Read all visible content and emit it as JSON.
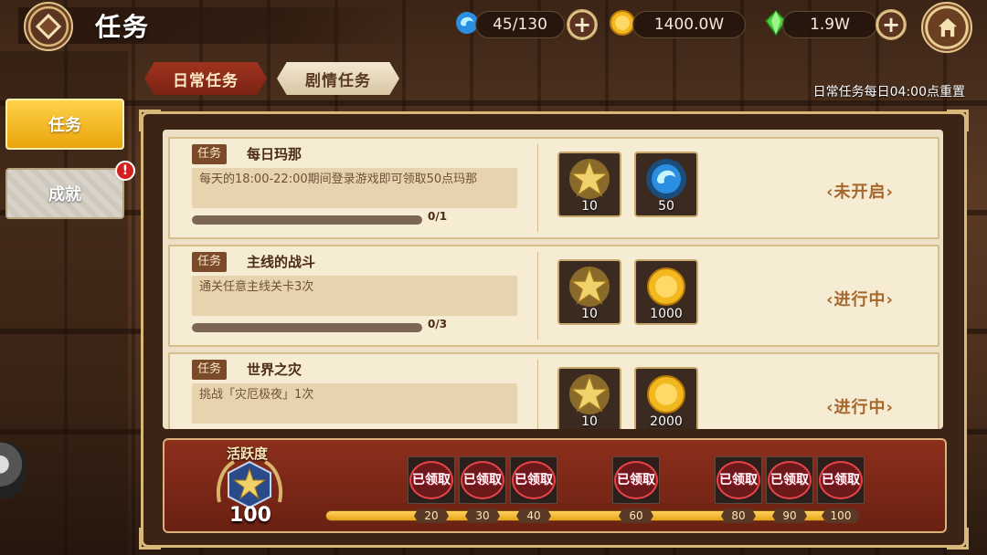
{
  "header": {
    "title": "任务",
    "resources": [
      {
        "name": "mana",
        "icon": "blue-spirit-icon",
        "value": "45/130"
      },
      {
        "name": "gold",
        "icon": "gold-coin-icon",
        "value": "1400.0W"
      },
      {
        "name": "gem",
        "icon": "green-crystal-icon",
        "value": "1.9W"
      }
    ]
  },
  "tabs": [
    {
      "label": "日常任务",
      "active": true
    },
    {
      "label": "剧情任务",
      "active": false
    }
  ],
  "reset_note": "日常任务每日04:00点重置",
  "side_menu": [
    {
      "label": "任务",
      "active": true
    },
    {
      "label": "成就",
      "active": false,
      "badge": "!"
    }
  ],
  "tasks": [
    {
      "tag": "任务",
      "name": "每日玛那",
      "description": "每天的18:00-22:00期间登录游戏即可领取50点玛那",
      "progress": "0/1",
      "progress_fraction": 0,
      "rewards": [
        {
          "icon": "gold-star-icon",
          "qty": "10"
        },
        {
          "icon": "blue-spirit-icon",
          "qty": "50"
        }
      ],
      "status": "未开启"
    },
    {
      "tag": "任务",
      "name": "主线的战斗",
      "description": "通关任意主线关卡3次",
      "progress": "0/3",
      "progress_fraction": 0,
      "rewards": [
        {
          "icon": "gold-star-icon",
          "qty": "10"
        },
        {
          "icon": "gold-coin-icon",
          "qty": "1000"
        }
      ],
      "status": "进行中"
    },
    {
      "tag": "任务",
      "name": "世界之灾",
      "description": "挑战「灾厄极夜」1次",
      "progress": "",
      "progress_fraction": 0,
      "rewards": [
        {
          "icon": "gold-star-icon",
          "qty": "10"
        },
        {
          "icon": "gold-coin-icon",
          "qty": "2000"
        }
      ],
      "status": "进行中"
    }
  ],
  "activity": {
    "label": "活跃度",
    "value": "100",
    "milestones": [
      "20",
      "30",
      "40",
      "60",
      "80",
      "90",
      "100"
    ],
    "claimed_label": "已领取",
    "fill_fraction": 1.0
  },
  "colors": {
    "active_tab": "#8c2a18",
    "active_side": "#f2b81d",
    "status_text": "#a5672c",
    "claimed_stamp": "#e6434a"
  }
}
